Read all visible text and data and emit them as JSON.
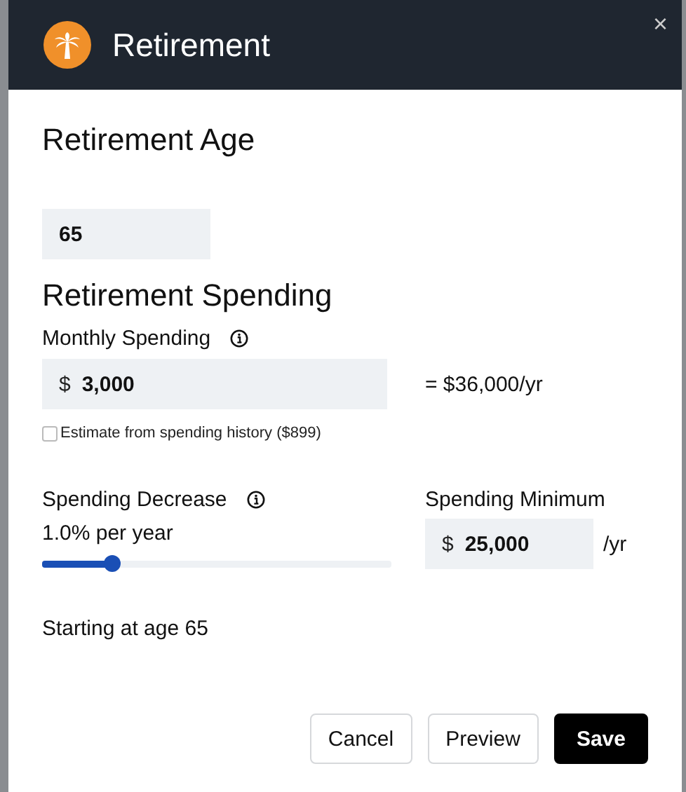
{
  "window": {
    "title": "Retirement",
    "close": "×"
  },
  "retirement_age": {
    "heading": "Retirement Age",
    "value": "65"
  },
  "retirement_spending": {
    "heading": "Retirement Spending",
    "monthly_spending": {
      "label": "Monthly Spending",
      "currency": "$",
      "value": "3,000",
      "annual": "= $36,000/yr"
    },
    "estimate": {
      "label": "Estimate from spending history ($899)",
      "checked": false
    },
    "spending_decrease": {
      "label": "Spending Decrease",
      "reading": "1.0% per year",
      "level": 0.2
    },
    "spending_minimum": {
      "label": "Spending Minimum",
      "currency": "$",
      "value": "25,000",
      "unit": "/yr"
    },
    "starting": "Starting at age 65"
  },
  "buttons": [
    {
      "label": "Cancel",
      "kind": "secondary"
    },
    {
      "label": "Preview",
      "kind": "secondary"
    },
    {
      "label": "Save",
      "kind": "primary"
    }
  ]
}
